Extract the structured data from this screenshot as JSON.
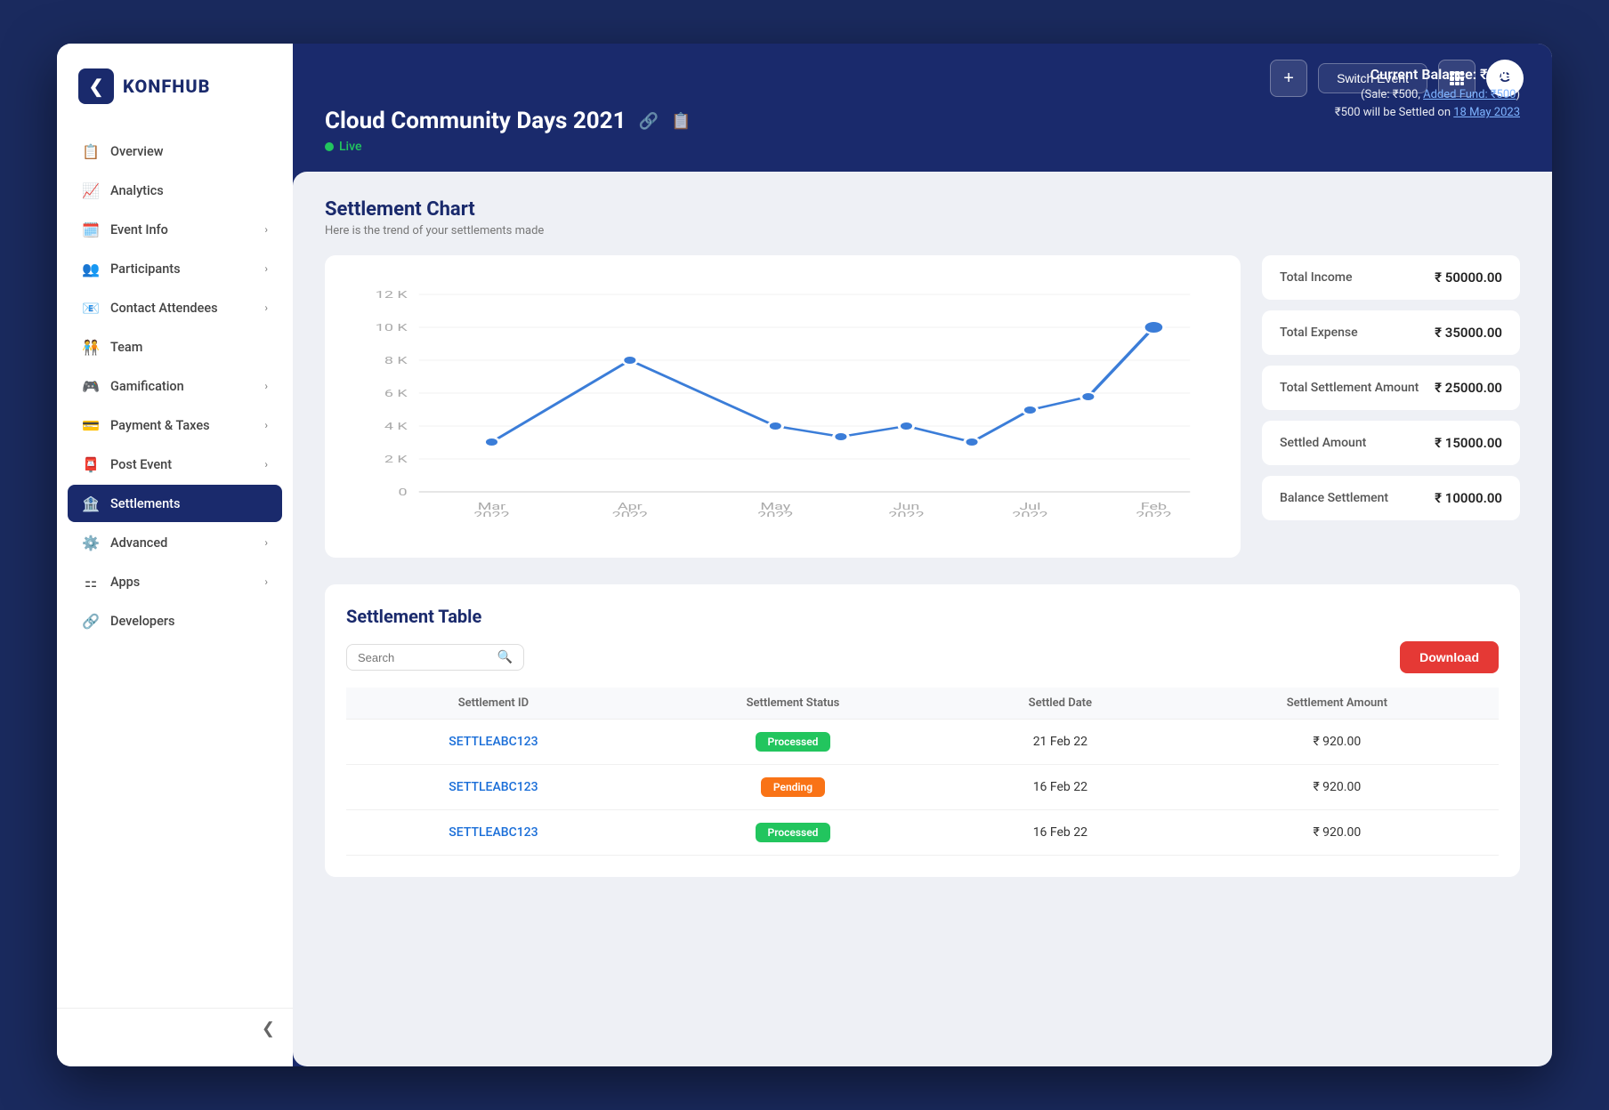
{
  "app": {
    "name": "KONFHUB",
    "logo_char": "❮"
  },
  "topbar": {
    "plus_label": "+",
    "switch_event_label": "Switch Event",
    "avatar_label": "G"
  },
  "event": {
    "title": "Cloud Community Days 2021",
    "status": "Live",
    "balance_label": "Current Balance: ₹1000",
    "balance_detail1": "(Sale: ₹500, Added Fund: ₹500)",
    "balance_detail2": "₹500 will be Settled on 18 May 2023"
  },
  "sidebar": {
    "items": [
      {
        "label": "Overview",
        "icon": "📋",
        "active": false,
        "has_chevron": false
      },
      {
        "label": "Analytics",
        "icon": "📈",
        "active": false,
        "has_chevron": false
      },
      {
        "label": "Event Info",
        "icon": "🗓️",
        "active": false,
        "has_chevron": true
      },
      {
        "label": "Participants",
        "icon": "👥",
        "active": false,
        "has_chevron": true
      },
      {
        "label": "Contact Attendees",
        "icon": "📧",
        "active": false,
        "has_chevron": true
      },
      {
        "label": "Team",
        "icon": "🧑‍🤝‍🧑",
        "active": false,
        "has_chevron": false
      },
      {
        "label": "Gamification",
        "icon": "🎮",
        "active": false,
        "has_chevron": true
      },
      {
        "label": "Payment & Taxes",
        "icon": "💳",
        "active": false,
        "has_chevron": true
      },
      {
        "label": "Post Event",
        "icon": "📮",
        "active": false,
        "has_chevron": true
      },
      {
        "label": "Settlements",
        "icon": "🏦",
        "active": true,
        "has_chevron": false
      },
      {
        "label": "Advanced",
        "icon": "⚙️",
        "active": false,
        "has_chevron": true
      },
      {
        "label": "Apps",
        "icon": "⚏",
        "active": false,
        "has_chevron": true
      },
      {
        "label": "Developers",
        "icon": "🔗",
        "active": false,
        "has_chevron": false
      }
    ]
  },
  "settlement_chart": {
    "title": "Settlement Chart",
    "subtitle": "Here is the trend of your settlements made",
    "x_labels": [
      "Mar\n2022",
      "Apr\n2022",
      "May\n2022",
      "Jun\n2022",
      "Jul\n2022",
      "Feb\n2022"
    ],
    "y_labels": [
      "0",
      "2K",
      "4K",
      "6K",
      "8K",
      "10K",
      "12K"
    ]
  },
  "stats": [
    {
      "label": "Total Income",
      "value": "₹ 50000.00"
    },
    {
      "label": "Total Expense",
      "value": "₹ 35000.00"
    },
    {
      "label": "Total Settlement Amount",
      "value": "₹ 25000.00"
    },
    {
      "label": "Settled Amount",
      "value": "₹ 15000.00"
    },
    {
      "label": "Balance Settlement",
      "value": "₹ 10000.00"
    }
  ],
  "settlement_table": {
    "title": "Settlement Table",
    "search_placeholder": "Search",
    "download_label": "Download",
    "columns": [
      "Settlement ID",
      "Settlement Status",
      "Settled Date",
      "Settlement Amount"
    ],
    "rows": [
      {
        "id": "SETTLEABC123",
        "status": "Processed",
        "status_type": "processed",
        "date": "21 Feb 22",
        "amount": "₹ 920.00"
      },
      {
        "id": "SETTLEABC123",
        "status": "Pending",
        "status_type": "pending",
        "date": "16 Feb 22",
        "amount": "₹ 920.00"
      },
      {
        "id": "SETTLEABC123",
        "status": "Processed",
        "status_type": "processed",
        "date": "16 Feb 22",
        "amount": "₹ 920.00"
      }
    ]
  }
}
